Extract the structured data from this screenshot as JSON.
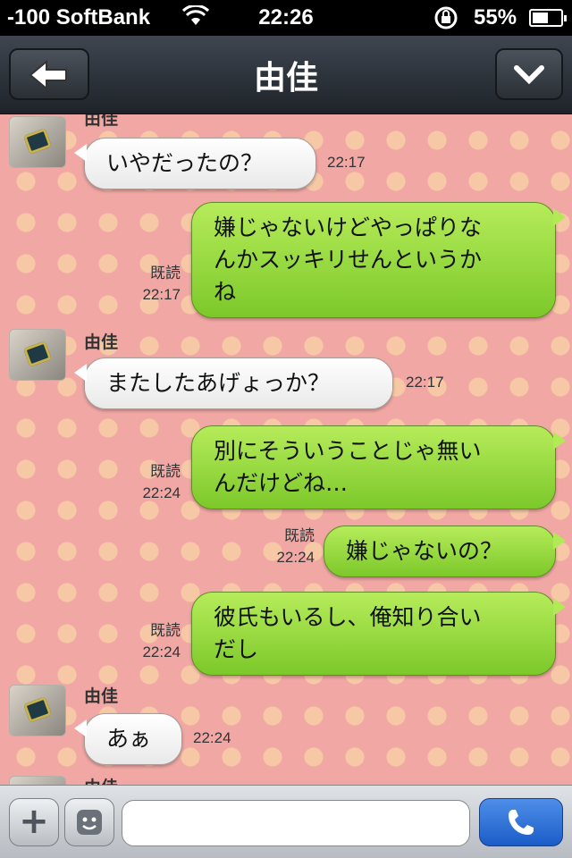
{
  "status_bar": {
    "carrier": "-100 SoftBank",
    "time": "22:26",
    "battery": "55%",
    "battery_level": 0.55
  },
  "nav": {
    "title": "由佳"
  },
  "messages": [
    {
      "side": "in",
      "sender": "由佳",
      "text": "いやだったの？",
      "time": "22:17"
    },
    {
      "side": "out",
      "lines": [
        "嫌じゃないけどやっぱりな",
        "んかスッキリせんというか",
        "ね"
      ],
      "read": "既読",
      "time": "22:17"
    },
    {
      "side": "in",
      "sender": "由佳",
      "text": "またしたあげょっか？",
      "time": "22:17"
    },
    {
      "side": "out",
      "lines": [
        "別にそういうことじゃ無い",
        "んだけどね…"
      ],
      "read": "既読",
      "time": "22:24"
    },
    {
      "side": "out",
      "lines": [
        "嫌じゃないの？"
      ],
      "read": "既読",
      "time": "22:24"
    },
    {
      "side": "out",
      "lines": [
        "彼氏もいるし、俺知り合い",
        "だし"
      ],
      "read": "既読",
      "time": "22:24"
    },
    {
      "side": "in",
      "sender": "由佳",
      "text": "あぁ",
      "time": "22:24"
    },
    {
      "side": "in",
      "sender": "由佳"
    }
  ],
  "input": {
    "value": ""
  },
  "icons": {
    "back": "back-arrow-icon",
    "down": "chevron-down-icon",
    "plus": "plus-icon",
    "sticker": "smiley-icon",
    "call": "phone-icon",
    "wifi": "wifi-icon",
    "rotation_lock": "rotation-lock-icon",
    "battery": "battery-icon"
  },
  "colors": {
    "outgoing_bubble": "#9ddc45",
    "incoming_bubble": "#ffffff",
    "chat_background": "#f1a8a4",
    "call_button": "#2f74dc"
  }
}
